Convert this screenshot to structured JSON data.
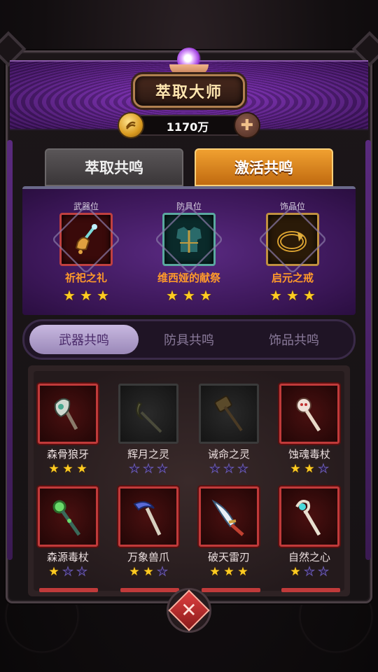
{
  "header": {
    "title": "萃取大师",
    "coin_amount": "1170万"
  },
  "tabs": [
    {
      "label": "萃取共鸣",
      "active": false
    },
    {
      "label": "激活共鸣",
      "active": true
    }
  ],
  "slots": [
    {
      "position_label": "武器位",
      "name": "祈祀之礼",
      "stars": 3,
      "max_stars": 3,
      "frame": "red",
      "icon": "bell-wand-icon"
    },
    {
      "position_label": "防具位",
      "name": "维西娅的献祭",
      "stars": 3,
      "max_stars": 3,
      "frame": "teal",
      "icon": "armor-icon"
    },
    {
      "position_label": "饰品位",
      "name": "启元之戒",
      "stars": 3,
      "max_stars": 3,
      "frame": "gold",
      "icon": "ring-icon"
    }
  ],
  "subtabs": [
    {
      "label": "武器共鸣",
      "active": true
    },
    {
      "label": "防具共鸣",
      "active": false
    },
    {
      "label": "饰品共鸣",
      "active": false
    }
  ],
  "items": [
    {
      "name": "森骨狼牙",
      "stars": 3,
      "max_stars": 3,
      "frame": "red",
      "icon": "bone-axe-icon"
    },
    {
      "name": "辉月之灵",
      "stars": 0,
      "max_stars": 3,
      "frame": "grey",
      "icon": "crescent-staff-icon"
    },
    {
      "name": "诫命之灵",
      "stars": 0,
      "max_stars": 3,
      "frame": "grey",
      "icon": "hammer-icon"
    },
    {
      "name": "蚀魂毒杖",
      "stars": 2,
      "max_stars": 3,
      "frame": "red",
      "icon": "skull-staff-icon"
    },
    {
      "name": "森源毒杖",
      "stars": 1,
      "max_stars": 3,
      "frame": "red",
      "icon": "green-orb-staff-icon"
    },
    {
      "name": "万象兽爪",
      "stars": 2,
      "max_stars": 3,
      "frame": "red",
      "icon": "claw-scythe-icon"
    },
    {
      "name": "破天雷刃",
      "stars": 3,
      "max_stars": 3,
      "frame": "red",
      "icon": "thunder-blade-icon"
    },
    {
      "name": "自然之心",
      "stars": 1,
      "max_stars": 3,
      "frame": "red",
      "icon": "nature-staff-icon"
    }
  ],
  "colors": {
    "accent_orange": "#f0a030",
    "purple_band": "#7a2ab0",
    "item_name_orange": "#ff9a2a",
    "red_frame": "#c03a3a"
  }
}
